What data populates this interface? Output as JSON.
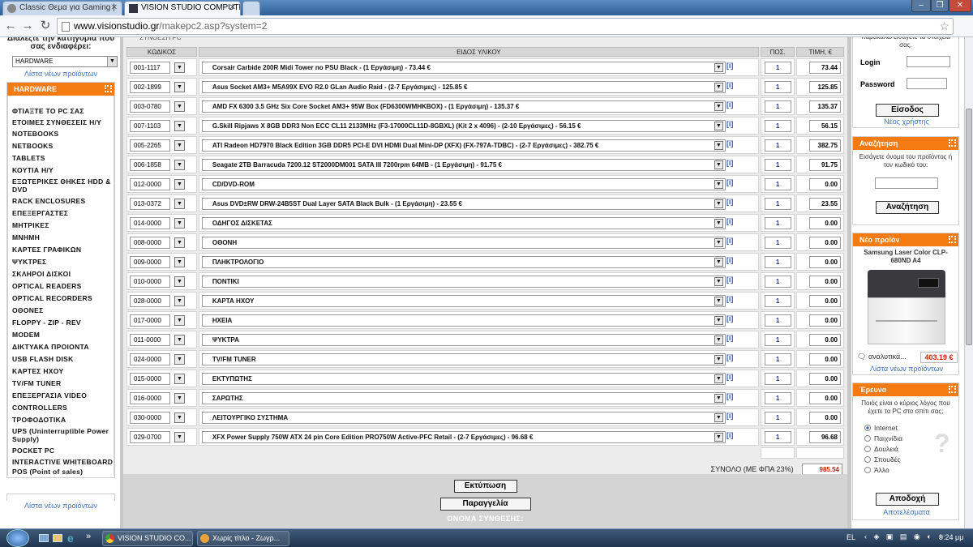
{
  "browser": {
    "tabs": [
      {
        "label": "Classic Θεμα για Gaming |",
        "active": false
      },
      {
        "label": "VISION STUDIO COMPUTE",
        "active": true
      }
    ],
    "url_host": "www.visionstudio.gr",
    "url_path": "/makepc2.asp?system=2"
  },
  "left": {
    "category_prompt": "Διαλέξτε την κατηγορία που σας ενδιαφέρει:",
    "category_selected": "HARDWARE",
    "new_products_link": "Λίστα νέων προϊόντων",
    "box_title": "HARDWARE",
    "nav": [
      "ΦΤΙΑΞΤΕ ΤΟ PC ΣΑΣ",
      "ΕΤΟΙΜΕΣ ΣΥΝΘΕΣΕΙΣ Η/Υ",
      "NOTEBOOKS",
      "NETBOOKS",
      "TABLETS",
      "ΚΟΥΤΙΑ Η/Υ",
      "ΕΞΩΤΕΡΙΚΕΣ ΘΗΚΕΣ HDD & DVD",
      "RACK ENCLOSURES",
      "ΕΠΕΞΕΡΓΑΣΤΕΣ",
      "ΜΗΤΡΙΚΕΣ",
      "ΜΝΗΜΗ",
      "ΚΑΡΤΕΣ ΓΡΑΦΙΚΩΝ",
      "ΨΥΚΤΡΕΣ",
      "ΣΚΛΗΡΟΙ ΔΙΣΚΟΙ",
      "OPTICAL READERS",
      "OPTICAL RECORDERS",
      "ΟΘΟΝΕΣ",
      "FLOPPY - ZIP - REV",
      "MODEM",
      "ΔΙΚΤΥΑΚΑ ΠΡΟΙΟΝΤΑ",
      "USB FLASH DISK",
      "ΚΑΡΤΕΣ ΗΧΟΥ",
      "TV/FM TUNER",
      "ΕΠΕΞΕΡΓΑΣΙΑ VIDEO",
      "CONTROLLERS",
      "ΤΡΟΦΟΔΟΤΙΚΑ",
      "UPS (Uninterruptible Power Supply)",
      "POCKET PC",
      "INTERACTIVE WHITEBOARD",
      "POS (Point of sales)"
    ],
    "footer_link": "Λίστα νέων προϊόντων"
  },
  "main": {
    "top_fragment": "ΣΥΝΘΕΣΗ PC",
    "headers": {
      "code": "ΚΩΔΙΚΟΣ",
      "item": "ΕΙΔΟΣ ΥΛΙΚΟΥ",
      "qty": "ΠΟΣ.",
      "price": "ΤΙΜΗ, €"
    },
    "info_glyph": "[i]",
    "rows": [
      {
        "code": "001-1117",
        "item": "Corsair Carbide 200R Midi Tower no PSU Black - (1 Εργάσιμη) - 73.44 €",
        "qty": "1",
        "price": "73.44"
      },
      {
        "code": "002-1899",
        "item": "Asus Socket AM3+ M5A99X EVO R2.0 GLan Audio Raid - (2-7 Εργάσιμες) - 125.85 €",
        "qty": "1",
        "price": "125.85"
      },
      {
        "code": "003-0780",
        "item": "AMD FX 6300 3.5 GHz Six Core Socket AM3+ 95W Box (FD6300WMHKBOX) - (1 Εργάσιμη) - 135.37 €",
        "qty": "1",
        "price": "135.37"
      },
      {
        "code": "007-1103",
        "item": "G.Skill Ripjaws X 8GB DDR3 Non ECC CL11 2133MHz (F3-17000CL11D-8GBXL) (Kit 2 x 4096) - (2-10 Εργάσιμες) - 56.15 €",
        "qty": "1",
        "price": "56.15"
      },
      {
        "code": "005-2265",
        "item": "ATI Radeon HD7970 Black Edition 3GB DDR5 PCI-E DVI HDMI Dual Mini-DP (XFX) (FX-797A-TDBC) - (2-7 Εργάσιμες) - 382.75 €",
        "qty": "1",
        "price": "382.75"
      },
      {
        "code": "006-1858",
        "item": "Seagate 2TB Barracuda 7200.12 ST2000DM001 SATA III 7200rpm 64MB - (1 Εργάσιμη) - 91.75 €",
        "qty": "1",
        "price": "91.75"
      },
      {
        "code": "012-0000",
        "item": "CD/DVD-ROM",
        "qty": "1",
        "price": "0.00"
      },
      {
        "code": "013-0372",
        "item": "Asus DVD±RW DRW-24B5ST Dual Layer SATA Black Bulk - (1 Εργάσιμη) - 23.55 €",
        "qty": "1",
        "price": "23.55"
      },
      {
        "code": "014-0000",
        "item": "ΟΔΗΓΟΣ ΔΙΣΚΕΤΑΣ",
        "qty": "1",
        "price": "0.00"
      },
      {
        "code": "008-0000",
        "item": "ΟΘΟΝΗ",
        "qty": "1",
        "price": "0.00"
      },
      {
        "code": "009-0000",
        "item": "ΠΛΗΚΤΡΟΛΟΓΙΟ",
        "qty": "1",
        "price": "0.00"
      },
      {
        "code": "010-0000",
        "item": "ΠΟΝΤΙΚΙ",
        "qty": "1",
        "price": "0.00"
      },
      {
        "code": "028-0000",
        "item": "ΚΑΡΤΑ ΗΧΟΥ",
        "qty": "1",
        "price": "0.00"
      },
      {
        "code": "017-0000",
        "item": "ΗΧΕΙΑ",
        "qty": "1",
        "price": "0.00"
      },
      {
        "code": "011-0000",
        "item": "ΨΥΚΤΡΑ",
        "qty": "1",
        "price": "0.00"
      },
      {
        "code": "024-0000",
        "item": "TV/FM TUNER",
        "qty": "1",
        "price": "0.00"
      },
      {
        "code": "015-0000",
        "item": "ΕΚΤΥΠΩΤΗΣ",
        "qty": "1",
        "price": "0.00"
      },
      {
        "code": "016-0000",
        "item": "ΣΑΡΩΤΗΣ",
        "qty": "1",
        "price": "0.00"
      },
      {
        "code": "030-0000",
        "item": "ΛΕΙΤΟΥΡΓΙΚΟ ΣΥΣΤΗΜΑ",
        "qty": "1",
        "price": "0.00"
      },
      {
        "code": "029-0700",
        "item": "XFX Power Supply 750W ATX 24 pin Core Edition PRO750W Active-PFC Retail - (2-7 Εργάσιμες) - 96.68 €",
        "qty": "1",
        "price": "96.68"
      }
    ],
    "total_label": "ΣΥΝΟΛΟ (ΜΕ ΦΠΑ 23%)",
    "total_value": "985.54",
    "print_button": "Εκτύπωση",
    "order_button": "Παραγγελία",
    "system_name_label": "ΟΝΟΜΑ ΣΥΝΘΕΣΗΣ:"
  },
  "right": {
    "login_note": "παρακαλώ εισάγετε τα στοιχεία σας.",
    "login_label": "Login",
    "password_label": "Password",
    "login_button": "Είσοδος",
    "new_user_link": "Νέος χρήστης",
    "search_title": "Αναζήτηση",
    "search_prompt": "Εισάγετε όνομα του προϊόντος ή τον κωδικό του:",
    "search_button": "Αναζήτηση",
    "new_product_title": "Νέο προϊόν",
    "new_product_name": "Samsung Laser Color CLP-680ND A4",
    "details_link": "αναλυτικά...",
    "new_product_price": "403.19 €",
    "new_list_link": "Λίστα νέων προϊόντων",
    "poll_title": "Έρευνα",
    "poll_question": "Ποιός είναι ο κύριος λόγος που έχετε το PC στο σπίτι σας;",
    "poll_options": [
      {
        "label": "Internet",
        "selected": true
      },
      {
        "label": "Παιχνίδια",
        "selected": false
      },
      {
        "label": "Δουλειά",
        "selected": false
      },
      {
        "label": "Σπουδές",
        "selected": false
      },
      {
        "label": "Άλλο",
        "selected": false
      }
    ],
    "poll_button": "Αποδοχή",
    "results_link": "Αποτελέσματα"
  },
  "taskbar": {
    "items": [
      {
        "label": "VISION STUDIO CO..."
      },
      {
        "label": "Χωρίς τίτλο - Ζωγρ..."
      }
    ],
    "language": "EL",
    "clock": "9:24 μμ"
  },
  "colors": {
    "accent": "#f47a12",
    "link": "#3e72b8",
    "price_red": "#cc2200"
  }
}
